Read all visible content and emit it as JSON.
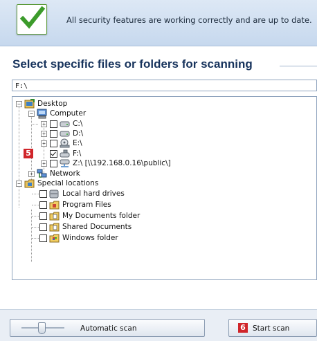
{
  "status": {
    "message": "All security features are working correctly and are up to date."
  },
  "panel": {
    "title": "Select specific files or folders for scanning",
    "path_value": "F:\\"
  },
  "tree": {
    "desktop": "Desktop",
    "computer": "Computer",
    "drives": [
      {
        "label": "C:\\",
        "checked": false
      },
      {
        "label": "D:\\",
        "checked": false
      },
      {
        "label": "E:\\",
        "checked": false
      },
      {
        "label": "F:\\",
        "checked": true
      },
      {
        "label": "Z:\\  [\\\\192.168.0.16\\public\\]",
        "checked": false
      }
    ],
    "network": "Network",
    "special": "Special locations",
    "special_items": [
      {
        "label": "Local hard drives"
      },
      {
        "label": "Program Files"
      },
      {
        "label": "My Documents folder"
      },
      {
        "label": "Shared Documents"
      },
      {
        "label": "Windows folder"
      }
    ]
  },
  "markers": {
    "f_drive": "5",
    "start_scan": "6"
  },
  "footer": {
    "automatic_scan": "Automatic scan",
    "start_scan": "Start scan"
  },
  "colors": {
    "title": "#17335c",
    "marker": "#d0252a",
    "check_green": "#3c9b2b"
  }
}
